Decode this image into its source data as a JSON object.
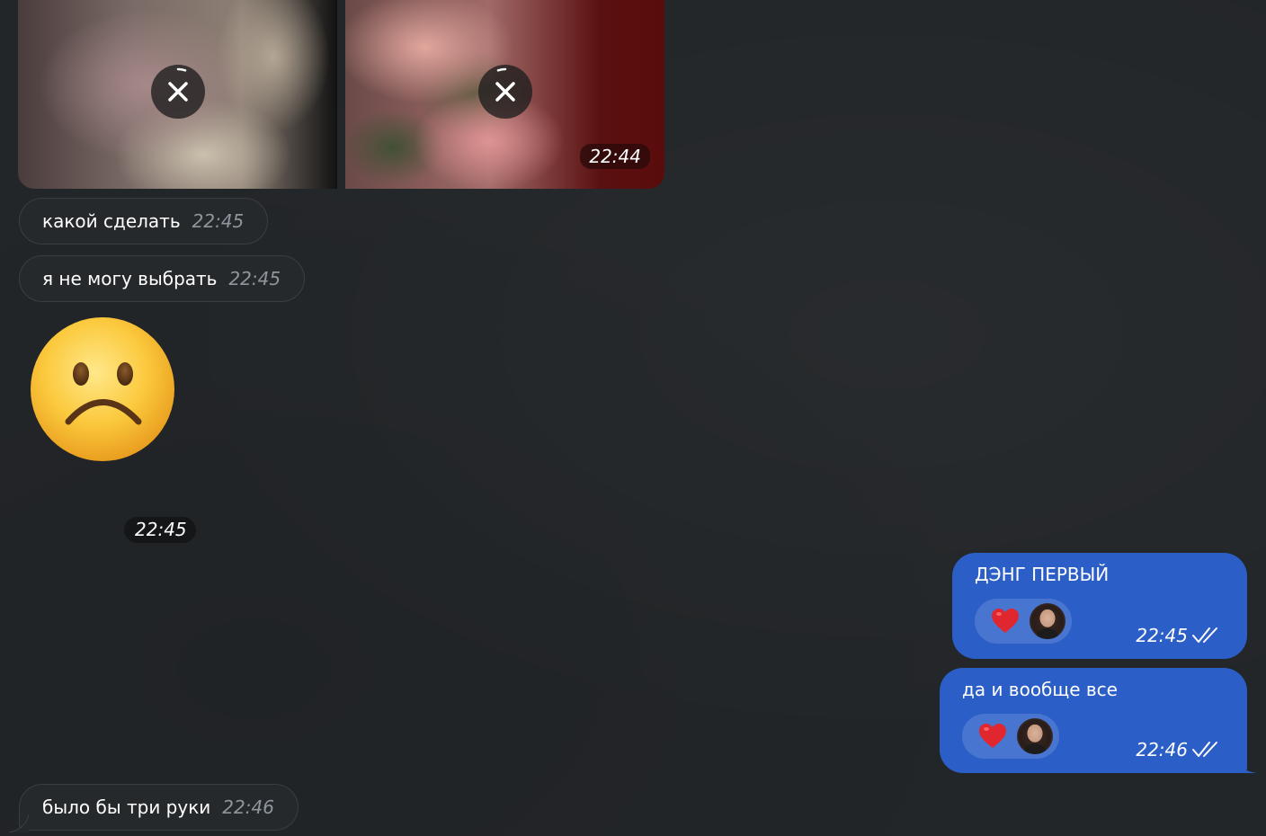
{
  "album": {
    "time": "22:44",
    "items": [
      {
        "icon": "cancel-upload-icon"
      },
      {
        "icon": "cancel-upload-icon"
      }
    ]
  },
  "incoming": [
    {
      "text": "какой сделать",
      "time": "22:45"
    },
    {
      "text": "я не могу выбрать",
      "time": "22:45"
    },
    {
      "text": "было бы три руки",
      "time": "22:46"
    }
  ],
  "sticker": {
    "emoji": "frowning-face-icon",
    "time": "22:45"
  },
  "outgoing": [
    {
      "text": "ДЭНГ ПЕРВЫЙ",
      "time": "22:45",
      "reaction": "heart-icon",
      "status": "read"
    },
    {
      "text": "да и вообще все",
      "time": "22:46",
      "reaction": "heart-icon",
      "status": "read"
    }
  ],
  "colors": {
    "background": "#232629",
    "incoming_bubble": "#26292c",
    "outgoing_bubble": "#2b5fc7",
    "heart": "#e0262e"
  }
}
